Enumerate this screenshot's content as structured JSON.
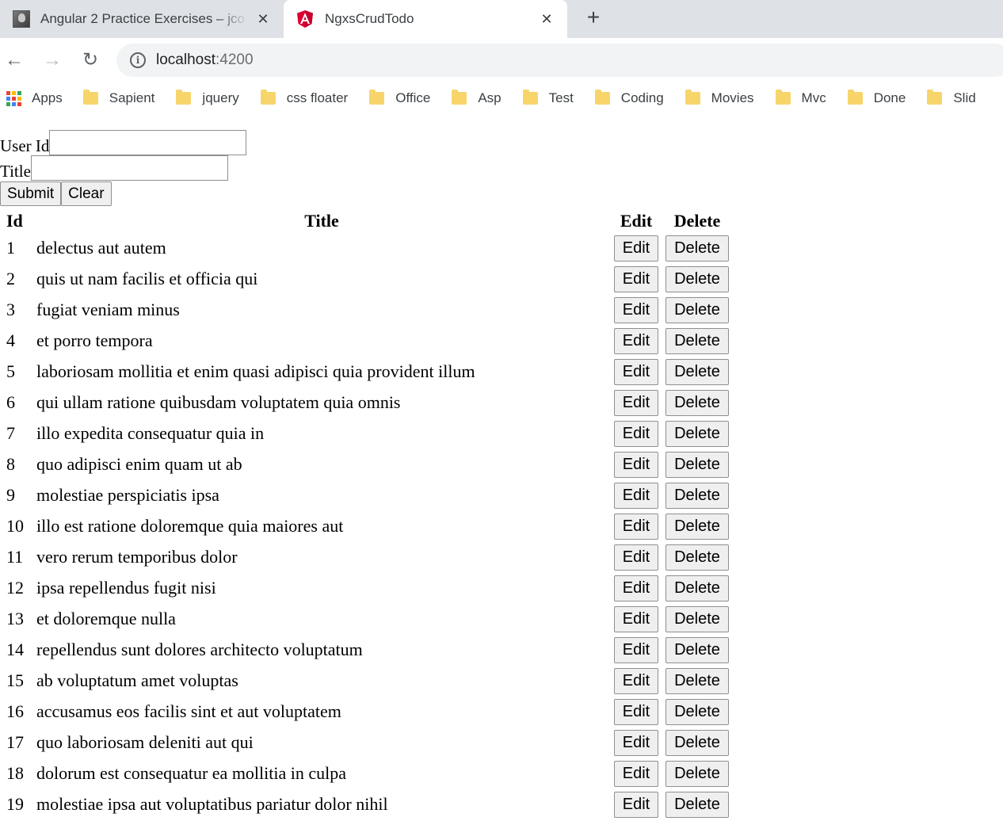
{
  "browser": {
    "tabs": [
      {
        "title": "Angular 2 Practice Exercises – jco",
        "active": false
      },
      {
        "title": "NgxsCrudTodo",
        "active": true
      }
    ],
    "url_host": "localhost",
    "url_port": ":4200",
    "bookmarks": [
      {
        "label": "Apps",
        "icon": "apps-icon"
      },
      {
        "label": "Sapient",
        "icon": "folder-icon"
      },
      {
        "label": "jquery",
        "icon": "folder-icon"
      },
      {
        "label": "css floater",
        "icon": "folder-icon"
      },
      {
        "label": "Office",
        "icon": "folder-icon"
      },
      {
        "label": "Asp",
        "icon": "folder-icon"
      },
      {
        "label": "Test",
        "icon": "folder-icon"
      },
      {
        "label": "Coding",
        "icon": "folder-icon"
      },
      {
        "label": "Movies",
        "icon": "folder-icon"
      },
      {
        "label": "Mvc",
        "icon": "folder-icon"
      },
      {
        "label": "Done",
        "icon": "folder-icon"
      },
      {
        "label": "Slid",
        "icon": "folder-icon"
      }
    ]
  },
  "form": {
    "user_id_label": "User Id",
    "user_id_value": "",
    "title_label": "Title",
    "title_value": "",
    "submit_label": "Submit",
    "clear_label": "Clear"
  },
  "table": {
    "headers": [
      "Id",
      "Title",
      "Edit",
      "Delete"
    ],
    "edit_label": "Edit",
    "delete_label": "Delete",
    "rows": [
      {
        "id": "1",
        "title": "delectus aut autem"
      },
      {
        "id": "2",
        "title": "quis ut nam facilis et officia qui"
      },
      {
        "id": "3",
        "title": "fugiat veniam minus"
      },
      {
        "id": "4",
        "title": "et porro tempora"
      },
      {
        "id": "5",
        "title": "laboriosam mollitia et enim quasi adipisci quia provident illum"
      },
      {
        "id": "6",
        "title": "qui ullam ratione quibusdam voluptatem quia omnis"
      },
      {
        "id": "7",
        "title": "illo expedita consequatur quia in"
      },
      {
        "id": "8",
        "title": "quo adipisci enim quam ut ab"
      },
      {
        "id": "9",
        "title": "molestiae perspiciatis ipsa"
      },
      {
        "id": "10",
        "title": "illo est ratione doloremque quia maiores aut"
      },
      {
        "id": "11",
        "title": "vero rerum temporibus dolor"
      },
      {
        "id": "12",
        "title": "ipsa repellendus fugit nisi"
      },
      {
        "id": "13",
        "title": "et doloremque nulla"
      },
      {
        "id": "14",
        "title": "repellendus sunt dolores architecto voluptatum"
      },
      {
        "id": "15",
        "title": "ab voluptatum amet voluptas"
      },
      {
        "id": "16",
        "title": "accusamus eos facilis sint et aut voluptatem"
      },
      {
        "id": "17",
        "title": "quo laboriosam deleniti aut qui"
      },
      {
        "id": "18",
        "title": "dolorum est consequatur ea mollitia in culpa"
      },
      {
        "id": "19",
        "title": "molestiae ipsa aut voluptatibus pariatur dolor nihil"
      }
    ]
  }
}
